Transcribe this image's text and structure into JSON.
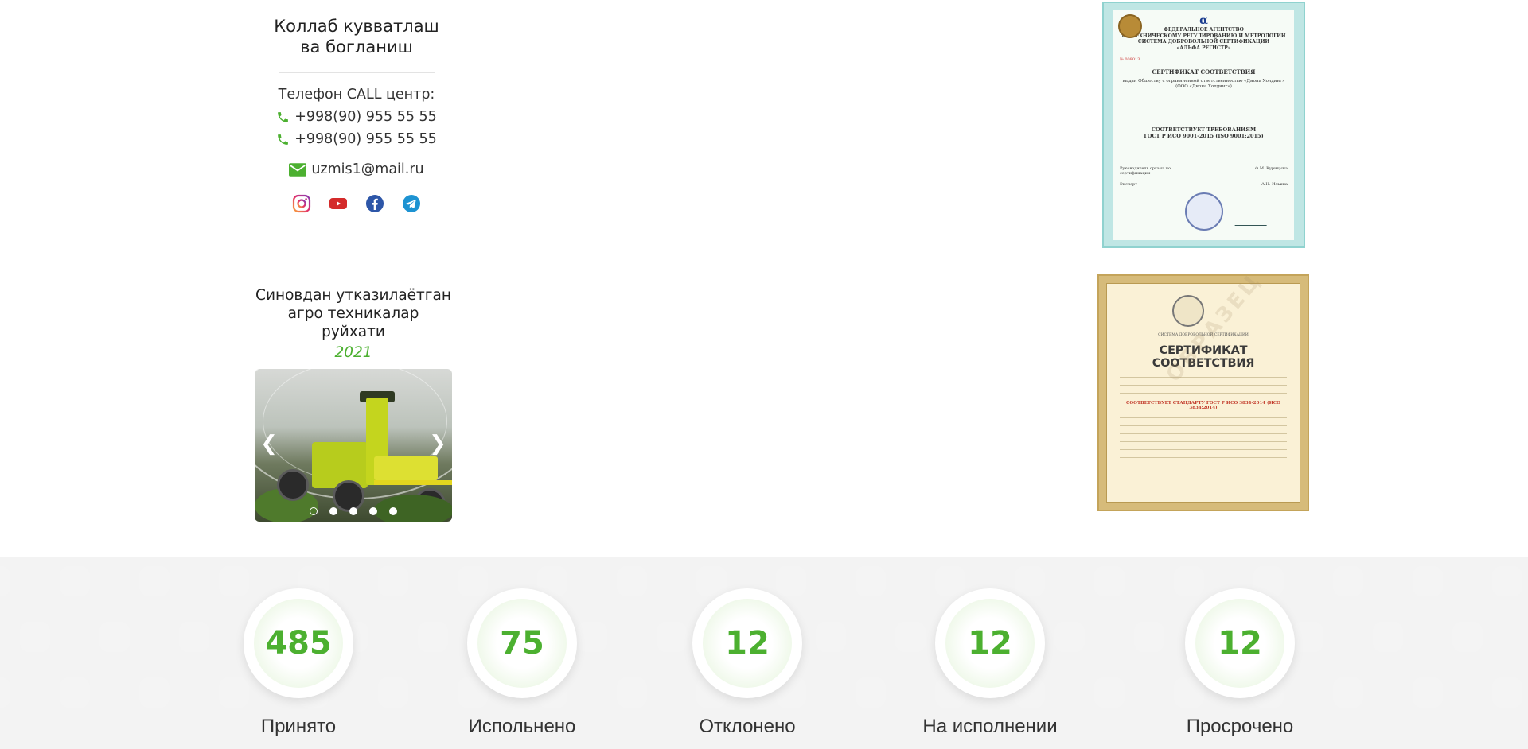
{
  "contact": {
    "title_line1": "Коллаб кувватлаш",
    "title_line2": "ва богланиш",
    "call_label": "Телефон CALL центр:",
    "phones": [
      "+998(90) 955 55 55",
      "+998(90) 955 55 55"
    ],
    "email": "uzmis1@mail.ru",
    "socials": [
      "instagram-icon",
      "youtube-icon",
      "facebook-icon",
      "telegram-icon"
    ]
  },
  "registry": {
    "title_line1": "Синовдан утказилаётган",
    "title_line2": "агро техникалар руйхати",
    "year": "2021",
    "slides_count": 5,
    "active_slide": 1,
    "prev_icon": "chevron-left-icon",
    "next_icon": "chevron-right-icon"
  },
  "cert1": {
    "head1": "ФЕДЕРАЛЬНОЕ АГЕНТСТВО",
    "head2": "ПО ТЕХНИЧЕСКОМУ РЕГУЛИРОВАНИЮ И МЕТРОЛОГИИ",
    "head3": "СИСТЕМА ДОБРОВОЛЬНОЙ СЕРТИФИКАЦИИ",
    "head4": "«АЛЬФА РЕГИСТР»",
    "number": "№ 008013",
    "title": "СЕРТИФИКАТ СООТВЕТСТВИЯ",
    "issued": "выдан Обществу с ограниченной ответственностью «Диона Холдинг» (ООО «Диона Холдинг»)",
    "std1": "СООТВЕТСТВУЕТ ТРЕБОВАНИЯМ",
    "std2": "ГОСТ Р ИСО 9001-2015 (ISO 9001:2015)",
    "row1_left": "Руководитель органа по сертификации",
    "row1_right": "Ф.М. Курицына",
    "row2_left": "Эксперт",
    "row2_right": "А.Н. Ильина"
  },
  "cert2": {
    "system": "СИСТЕМА ДОБРОВОЛЬНОЙ СЕРТИФИКАЦИИ",
    "title": "СЕРТИФИКАТ СООТВЕТСТВИЯ",
    "red": "СООТВЕТСТВУЕТ СТАНДАРТУ ГОСТ Р ИСО 3834-2014 (ИСО 3834:2014)",
    "watermark": "ОБРАЗЕЦ"
  },
  "stats": [
    {
      "value": "485",
      "label": "Принято"
    },
    {
      "value": "75",
      "label": "Испольнено"
    },
    {
      "value": "12",
      "label": "Отклонено"
    },
    {
      "value": "12",
      "label": "На исполнении"
    },
    {
      "value": "12",
      "label": "Просрочено"
    }
  ],
  "colors": {
    "accent": "#4cb030",
    "text": "#222222"
  }
}
